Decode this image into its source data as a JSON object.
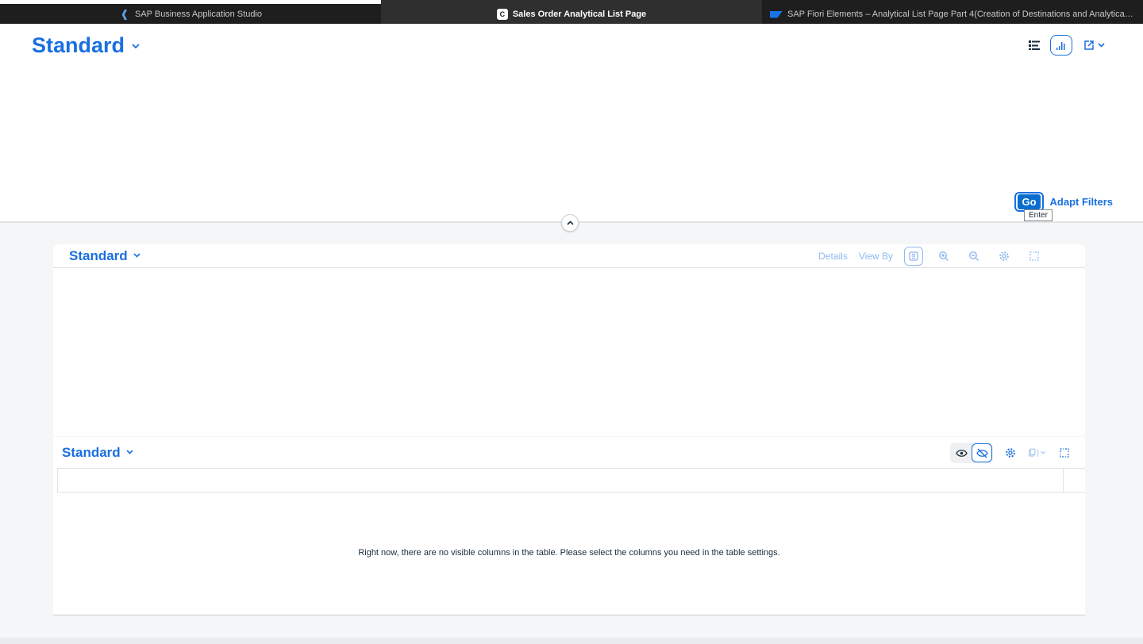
{
  "browser": {
    "tabs": [
      {
        "title": "SAP Business Application Studio",
        "favicon": "bas-icon"
      },
      {
        "title": "Sales Order Analytical List Page",
        "favicon": "c-icon",
        "favicon_letter": "C"
      },
      {
        "title": "SAP Fiori Elements – Analytical List Page Part 4(Creation of Destinations and Analytical List...",
        "favicon": "sap-logo-icon"
      }
    ]
  },
  "header": {
    "variant_label": "Standard",
    "go_label": "Go",
    "adapt_filters_label": "Adapt Filters",
    "tooltip": "Enter"
  },
  "chart": {
    "variant_label": "Standard",
    "details_label": "Details",
    "view_by_label": "View By"
  },
  "table": {
    "variant_label": "Standard",
    "no_data_text": "Right now, there are no visible columns in the table. Please select the columns you need in the table settings."
  },
  "colors": {
    "accent": "#1a6fe0",
    "disabled_accent": "#8fb8ee",
    "background": "#f5f6f7"
  }
}
